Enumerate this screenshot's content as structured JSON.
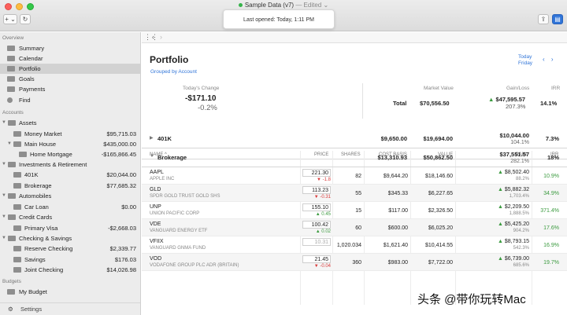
{
  "window": {
    "title": "Sample Data (v7)",
    "edited": "— Edited ⌄",
    "last_opened": "Last opened: Today, 1:11 PM",
    "add_label": "+ ⌄",
    "refresh_label": "↻"
  },
  "sidebar": {
    "overview_label": "Overview",
    "overview": [
      {
        "label": "Summary",
        "icon": "summary-icon"
      },
      {
        "label": "Calendar",
        "icon": "calendar-icon"
      },
      {
        "label": "Portfolio",
        "icon": "portfolio-icon"
      },
      {
        "label": "Goals",
        "icon": "goals-icon"
      },
      {
        "label": "Payments",
        "icon": "payments-icon"
      },
      {
        "label": "Find",
        "icon": "search-icon"
      }
    ],
    "accounts_label": "Accounts",
    "accounts": [
      {
        "label": "Assets",
        "amount": ""
      },
      {
        "label": "Money Market",
        "amount": "$95,715.03"
      },
      {
        "label": "Main House",
        "amount": "$435,000.00"
      },
      {
        "label": "Home Mortgage",
        "amount": "-$165,866.45"
      },
      {
        "label": "Investments & Retirement",
        "amount": ""
      },
      {
        "label": "401K",
        "amount": "$20,044.00"
      },
      {
        "label": "Brokerage",
        "amount": "$77,685.32"
      },
      {
        "label": "Automobiles",
        "amount": ""
      },
      {
        "label": "Car Loan",
        "amount": "$0.00"
      },
      {
        "label": "Credit Cards",
        "amount": ""
      },
      {
        "label": "Primary Visa",
        "amount": "-$2,668.03"
      },
      {
        "label": "Checking & Savings",
        "amount": ""
      },
      {
        "label": "Reserve Checking",
        "amount": "$2,339.77"
      },
      {
        "label": "Savings",
        "amount": "$176.03"
      },
      {
        "label": "Joint Checking",
        "amount": "$14,026.98"
      }
    ],
    "budgets_label": "Budgets",
    "budgets": [
      {
        "label": "My Budget"
      }
    ],
    "settings_label": "Settings"
  },
  "main": {
    "title": "Portfolio",
    "grouped_by": "Grouped by Account",
    "date_top": "Today",
    "date_bottom": "Friday",
    "summary": {
      "todays_change_label": "Today's Change",
      "todays_change": "-$171.10",
      "todays_change_pct": "-0.2%",
      "market_value_label": "Market Value",
      "gain_loss_label": "Gain/Loss",
      "irr_label": "IRR",
      "total_label": "Total",
      "total_value": "$70,556.50",
      "total_gain": "$47,595.57",
      "total_gain_pct": "207.3%",
      "total_irr": "14.1%"
    },
    "columns": {
      "name": "NAME ^",
      "price": "PRICE",
      "shares": "SHARES",
      "cost_basis": "COST BASIS",
      "value": "VALUE",
      "gain": "GAIN",
      "irr": "IRR"
    },
    "groups": [
      {
        "name": "401K",
        "cost": "$9,650.00",
        "value": "$19,694.00",
        "gain": "$10,044.00",
        "gain_pct": "104.1%",
        "irr": "7.3%"
      },
      {
        "name": "Brokerage",
        "cost": "$13,310.93",
        "value": "$50,862.50",
        "gain": "$37,551.57",
        "gain_pct": "282.1%",
        "irr": "18%"
      }
    ],
    "holdings": [
      {
        "symbol": "AAPL",
        "name": "APPLE INC",
        "price": "221.30",
        "change": "▼ -1.8",
        "dir": "down",
        "shares": "82",
        "cost": "$9,644.20",
        "value": "$18,146.60",
        "gain": "▲ $8,502.40",
        "gain_pct": "88.2%",
        "irr": "10.9%"
      },
      {
        "symbol": "GLD",
        "name": "SPDR GOLD TRUST GOLD SHS",
        "price": "113.23",
        "change": "▼ -0.31",
        "dir": "down",
        "shares": "55",
        "cost": "$345.33",
        "value": "$6,227.65",
        "gain": "▲ $5,882.32",
        "gain_pct": "1,703.4%",
        "irr": "34.9%"
      },
      {
        "symbol": "UNP",
        "name": "UNION PACIFIC CORP",
        "price": "155.10",
        "change": "▲ 0.45",
        "dir": "up",
        "shares": "15",
        "cost": "$117.00",
        "value": "$2,326.50",
        "gain": "▲ $2,209.50",
        "gain_pct": "1,888.5%",
        "irr": "371.4%"
      },
      {
        "symbol": "VDE",
        "name": "VANGUARD ENERGY ETF",
        "price": "100.42",
        "change": "▲ 0.02",
        "dir": "up",
        "shares": "60",
        "cost": "$600.00",
        "value": "$6,025.20",
        "gain": "▲ $5,425.20",
        "gain_pct": "904.2%",
        "irr": "17.6%"
      },
      {
        "symbol": "VFIIX",
        "name": "VANGUARD GNMA FUND",
        "price": "10.31",
        "change": "",
        "dir": "none",
        "shares": "1,020.034",
        "cost": "$1,621.40",
        "value": "$10,414.55",
        "gain": "▲ $8,793.15",
        "gain_pct": "542.3%",
        "irr": "16.9%"
      },
      {
        "symbol": "VOD",
        "name": "VODAFONE GROUP PLC ADR (BRITAIN)",
        "price": "21.45",
        "change": "▼ -0.04",
        "dir": "down",
        "shares": "360",
        "cost": "$983.00",
        "value": "$7,722.00",
        "gain": "▲ $6,739.00",
        "gain_pct": "685.6%",
        "irr": "19.7%"
      }
    ]
  },
  "watermark": "头条 @带你玩转Mac",
  "colors": {
    "accent": "#2f74d8",
    "gain": "#3a9a3e",
    "loss": "#d93a3a"
  }
}
